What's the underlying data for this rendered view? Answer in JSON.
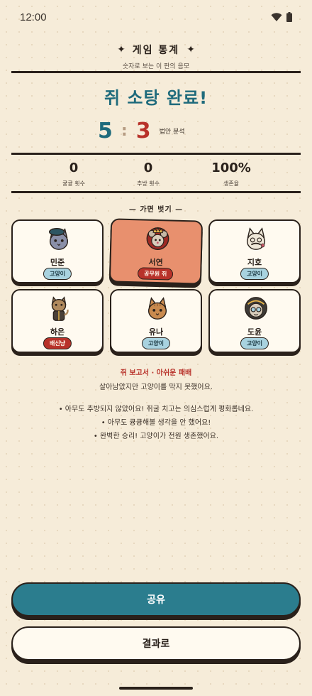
{
  "status_bar": {
    "time": "12:00",
    "icons": [
      "wifi-icon",
      "battery-icon"
    ]
  },
  "header": {
    "title": "게임 통계",
    "subtitle": "숫자로 보는 이 판의 음모",
    "ornament": "✦"
  },
  "result": {
    "title": "쥐 소탕 완료!",
    "score_cat": "5",
    "score_separator": ":",
    "score_mouse": "3",
    "score_label": "법안 분석"
  },
  "stats": [
    {
      "value": "0",
      "label": "큥큥 횟수"
    },
    {
      "value": "0",
      "label": "추방 횟수"
    },
    {
      "value": "100%",
      "label": "생존율"
    }
  ],
  "reveal": {
    "title": "— 가면 벗기 —",
    "players": [
      {
        "name": "민준",
        "role": "고양이",
        "avatar": "cat-beret-icon"
      },
      {
        "name": "서연",
        "role": "공무원 쥐",
        "avatar": "mouse-king-icon"
      },
      {
        "name": "지호",
        "role": "고양이",
        "avatar": "cat-mustache-icon"
      },
      {
        "name": "하은",
        "role": "배신냥",
        "avatar": "cat-suit-icon"
      },
      {
        "name": "유나",
        "role": "고양이",
        "avatar": "cat-plain-icon"
      },
      {
        "name": "도윤",
        "role": "고양이",
        "avatar": "cat-hood-icon"
      }
    ]
  },
  "report": {
    "title": "쥐 보고서 · 아쉬운 패배",
    "subtitle": "살아남았지만 고양이를 막지 못했어요.",
    "notes": [
      "• 아무도 추방되지 않았어요! 쥐굴 치고는 의심스럽게 평화롭네요.",
      "• 아무도 큥큥해볼 생각을 안 했어요!",
      "• 완벽한 승리! 고양이가 전원 생존했어요."
    ]
  },
  "buttons": {
    "share": "공유",
    "results": "결과로"
  },
  "colors": {
    "background": "#f6ecd9",
    "cat_team": "#1f6b7c",
    "mouse_team": "#b8322a",
    "share_button": "#2b7d8e",
    "highlight_card": "#e8906e",
    "cat_badge": "#a8d2df",
    "ink": "#2a211b"
  }
}
